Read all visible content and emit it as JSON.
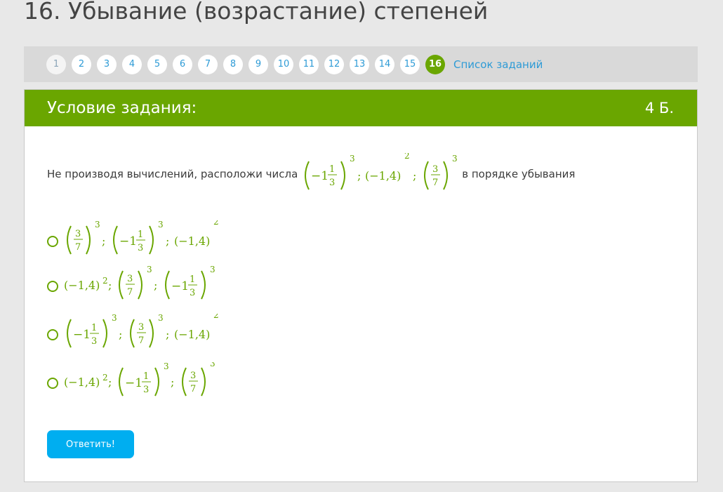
{
  "page_title": "16. Убывание (возрастание) степеней",
  "nav": {
    "items": [
      "1",
      "2",
      "3",
      "4",
      "5",
      "6",
      "7",
      "8",
      "9",
      "10",
      "11",
      "12",
      "13",
      "14",
      "15",
      "16"
    ],
    "active": "16",
    "task_list_link": "Список заданий"
  },
  "card": {
    "title": "Условие задания:",
    "points": "4 Б."
  },
  "question": {
    "text_before": "Не производя вычислений, расположи числа",
    "text_after": "в порядке убывания"
  },
  "math": {
    "base_m1_1_3": "−1",
    "num_1": "1",
    "den_3": "3",
    "num_3": "3",
    "den_7": "7",
    "neg14": "(−1,4)",
    "exp3": "3",
    "exp2": "2",
    "sep": ";"
  },
  "options": [
    {
      "order": [
        "3/7",
        "-1 1/3",
        "-1,4"
      ]
    },
    {
      "order": [
        "-1,4",
        "3/7",
        "-1 1/3"
      ]
    },
    {
      "order": [
        "-1 1/3",
        "3/7",
        "-1,4"
      ]
    },
    {
      "order": [
        "-1,4",
        "-1 1/3",
        "3/7"
      ]
    }
  ],
  "submit_label": "Ответить!",
  "colors": {
    "accent_green": "#6aa600",
    "link_blue": "#2e9bd6",
    "button_blue": "#00aef0"
  }
}
